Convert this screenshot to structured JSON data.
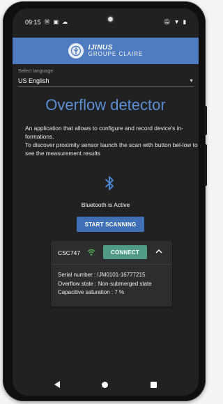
{
  "status_bar": {
    "time": "09:15",
    "left_icons": [
      "signal-m-icon",
      "notification-icon",
      "cloud-icon"
    ],
    "right_icons": [
      "mute-icon",
      "wifi-icon",
      "battery-icon"
    ]
  },
  "app_bar": {
    "brand_top": "IJINUS",
    "brand_bottom": "GROUPE CLAIRE",
    "logo_icon": "ijinus-logo-icon",
    "color": "#4f7cc0"
  },
  "language": {
    "label": "Select language",
    "value": "US English"
  },
  "main": {
    "title": "Overflow detector",
    "description_1": "An application that allows to configure and record device's in-formations.",
    "description_2": "To discover proximity sensor launch the scan with button bel-low to see the measurement results",
    "bluetooth_icon": "bluetooth-icon",
    "bluetooth_status": "Bluetooth is Active",
    "scan_button": "START SCANNING"
  },
  "device_card": {
    "name": "CSC747",
    "signal_icon": "wifi-signal-icon",
    "connect_button": "CONNECT",
    "expand_icon": "chevron-up-icon",
    "serial": "Serial number : IJM0101-16777215",
    "overflow_state": "Overflow state : Non-submerged state",
    "capacitive": "Capacitive saturation : 7 %"
  },
  "colors": {
    "accent": "#5b8fd6",
    "scan_button": "#3f6fb5",
    "connect_button": "#4f9b86",
    "background": "#212121"
  }
}
